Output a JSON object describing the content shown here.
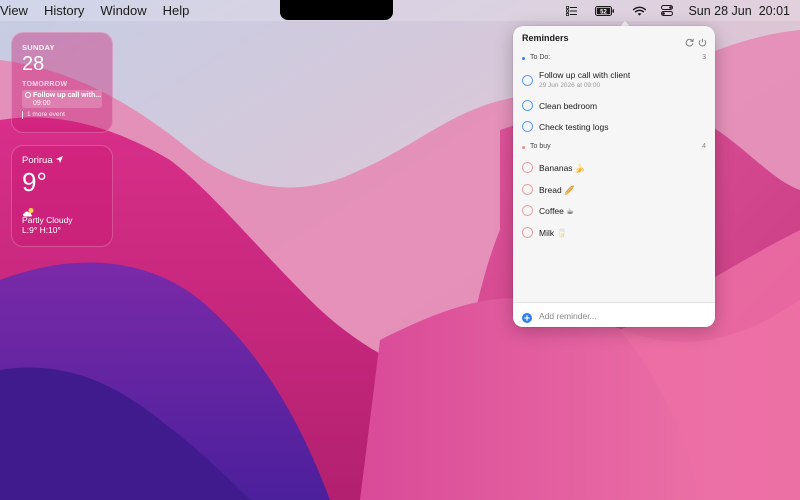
{
  "menubar": {
    "menus": [
      "View",
      "History",
      "Window",
      "Help"
    ],
    "status_icons": [
      "reminders-icon",
      "battery-icon",
      "wifi-icon",
      "control-center-icon"
    ],
    "battery_level": "52",
    "date": "Sun 28 Jun",
    "time": "20:01"
  },
  "calendar_widget": {
    "weekday": "SUNDAY",
    "day": "28",
    "tomorrow_label": "TOMORROW",
    "event_title": "Follow up call with...",
    "event_time": "09:00",
    "more_events": "1 more event"
  },
  "weather_widget": {
    "city": "Porirua",
    "temperature": "9°",
    "condition": "Partly Cloudy",
    "hi_lo": "L:9° H:10°",
    "condition_icon": "partly-cloudy-icon"
  },
  "reminders": {
    "title": "Reminders",
    "sections": [
      {
        "name": "To Do:",
        "count": "3",
        "color": "#3b82f6",
        "items": [
          {
            "title": "Follow up call with client",
            "subtitle": "29 Jun 2026 at 09:00"
          },
          {
            "title": "Clean bedroom"
          },
          {
            "title": "Check testing logs"
          }
        ]
      },
      {
        "name": "To buy",
        "count": "4",
        "color": "#e8909a",
        "items": [
          {
            "title": "Bananas 🍌"
          },
          {
            "title": "Bread 🥖"
          },
          {
            "title": "Coffee ☕"
          },
          {
            "title": "Milk 🥛"
          }
        ]
      }
    ],
    "add_placeholder": "Add reminder..."
  },
  "colors": {
    "todo_accent": "#3b82f6",
    "tobuy_accent": "#e8909a",
    "add_button": "#2f7ff0"
  }
}
